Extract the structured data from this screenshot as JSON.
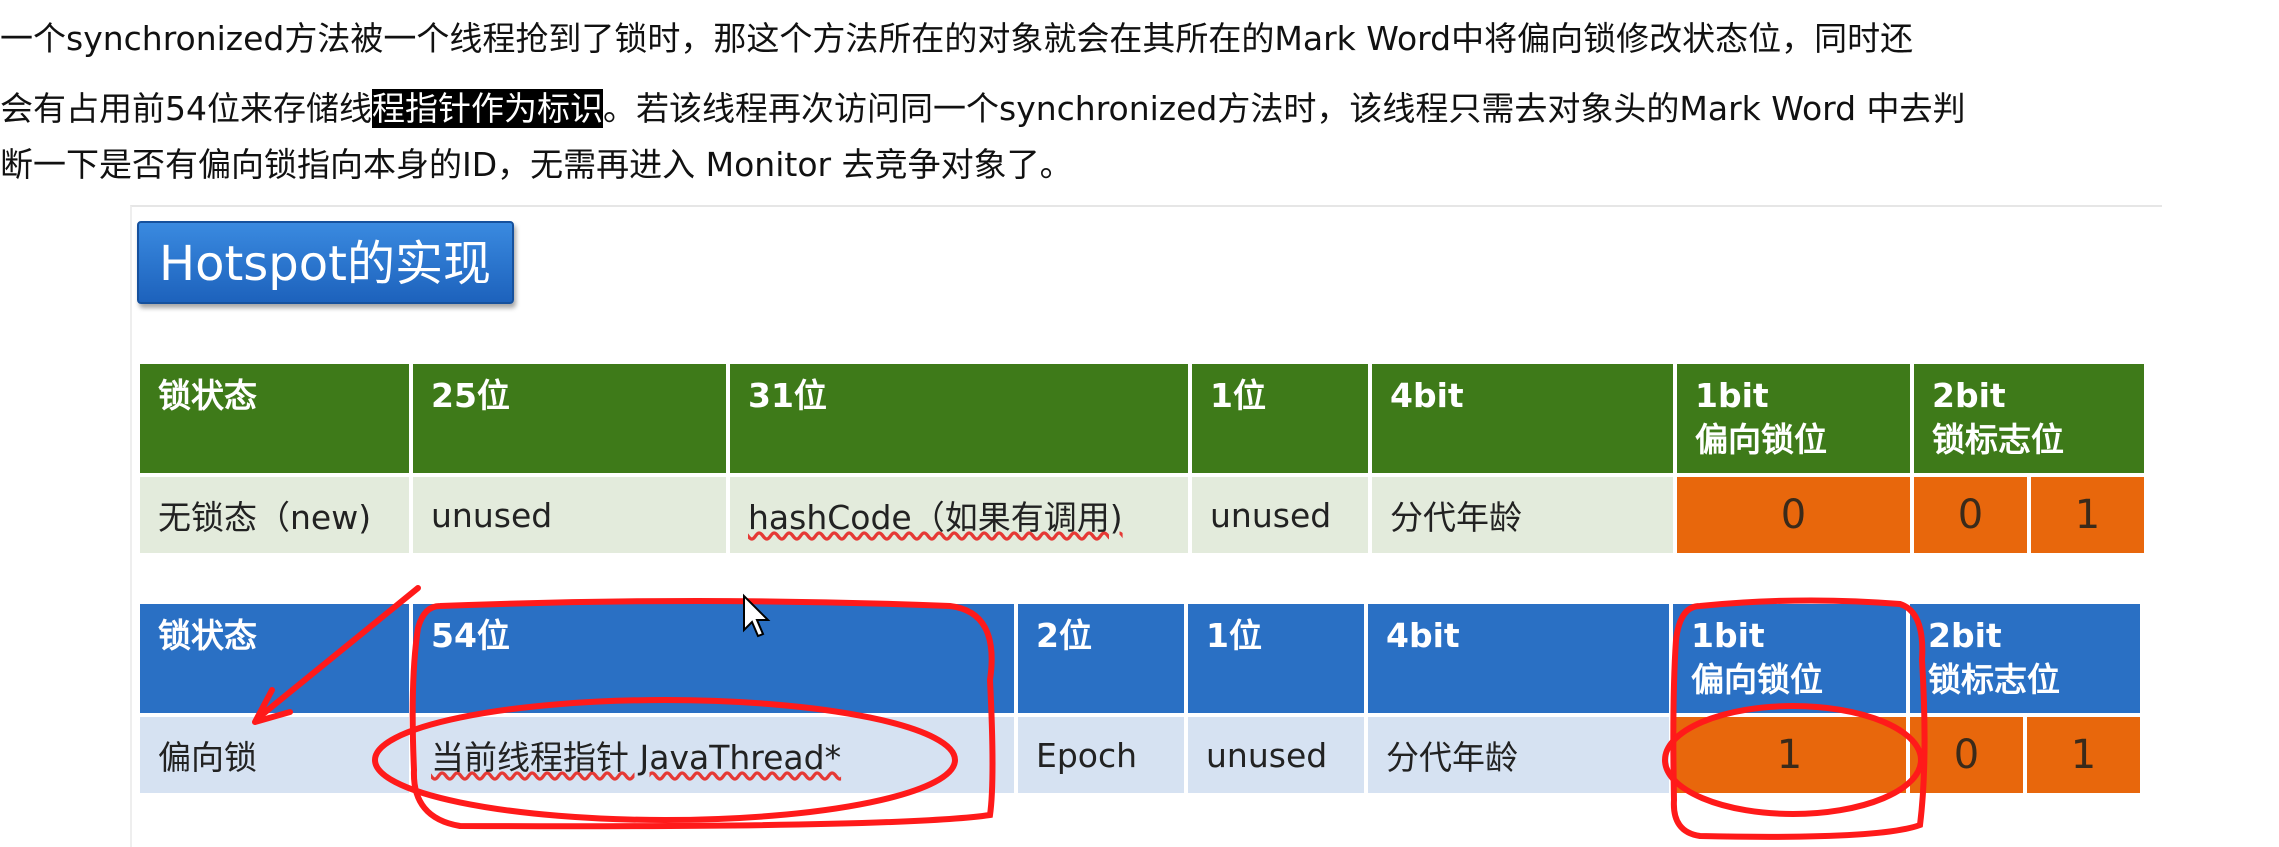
{
  "paragraph": {
    "line1": "一个synchronized方法被一个线程抢到了锁时，那这个方法所在的对象就会在其所在的Mark Word中将偏向锁修改状态位，同时还",
    "line2_pre": "会有占用前54位来存储线",
    "line2_highlight": "程指针作为标识",
    "line2_post": "。若该线程再次访问同一个synchronized方法时，该线程只需去对象头的Mark Word 中去判",
    "line3": "断一下是否有偏向锁指向本身的ID，无需再进入 Monitor 去竞争对象了。"
  },
  "slide": {
    "title": "Hotspot的实现",
    "table1": {
      "headers": [
        "锁状态",
        "25位",
        "31位",
        "1位",
        "4bit",
        "1bit",
        "偏向锁位",
        "2bit",
        "锁标志位"
      ],
      "row": [
        "无锁态（new)",
        "unused",
        "hashCode（如果有调用)",
        "unused",
        "分代年龄",
        "0",
        "0",
        "1"
      ]
    },
    "table2": {
      "headers": [
        "锁状态",
        "54位",
        "2位",
        "1位",
        "4bit",
        "1bit",
        "偏向锁位",
        "2bit",
        "锁标志位"
      ],
      "row": [
        "偏向锁",
        "当前线程指针 JavaThread*",
        "Epoch",
        "unused",
        "分代年龄",
        "1",
        "0",
        "1"
      ]
    }
  },
  "colors": {
    "green_header": "#3e7a19",
    "blue_header": "#2a70c4",
    "orange_cell": "#e8670c",
    "annotation_red": "#ff1a1a"
  }
}
